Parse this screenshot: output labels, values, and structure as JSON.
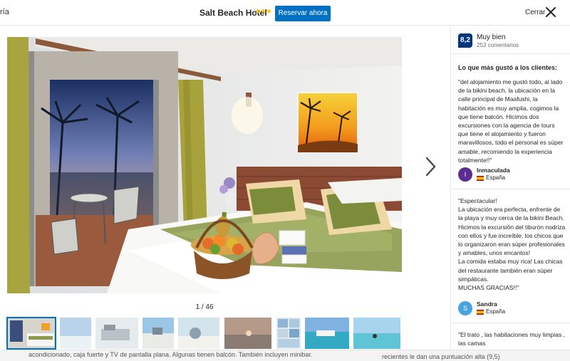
{
  "header": {
    "breadcrumb_fragment": "ría",
    "hotel_name": "Salt Beach Hotel",
    "stars": "★★★",
    "reserve_label": "Reservar ahora",
    "close_label": "Cerrar"
  },
  "gallery": {
    "counter": "1 / 46",
    "thumbnail_count": 10,
    "active_thumbnail": 1
  },
  "background_page": {
    "left_text": "acondicionado, caja fuerte y TV de pantalla plana. Algunas tienen balcón. También incluyen minibar.",
    "right_text": "recientes le dan una puntuación alta (9,5)"
  },
  "sidebar": {
    "score": "8,2",
    "score_word": "Muy bien",
    "review_count": "253 comentarios",
    "liked_heading": "Lo que más gustó a los clientes:",
    "reviews": [
      {
        "text": "\"del alojamiento me gustó todo, al lado de la bikini beach, la ubicación en la calle principal de Maafushi, la habitación es muy amplia, cogimos la que tiene balcón. Hicimos dos excursiones con la agencia de tours que tiene el alojamiento y fueron maravillosos, todo el personal es súper amable, recomiendo la experiencia totalmente!!\"",
        "initial": "I",
        "name": "Inmaculada",
        "country": "España",
        "avatar_color": "#5c2d91"
      },
      {
        "text": "\"Espectacular!\nLa ubicación era perfecta, enfrente de la playa y muy cerca de la bikini Beach. Hicimos la excursión del tiburón nodriza con ellos y fue increíble, los chicos que lo organizaron eran súper profesionales y amables, unos encantos!\nLa comida estaba muy rica! Las chicas del restaurante también eran súper simpáticas.\nMUCHAS GRACIAS!!\"",
        "initial": "S",
        "name": "Sandra",
        "country": "España",
        "avatar_color": "#4aa3df"
      },
      {
        "text": "\"El trato , las habitaciones muy limpias , las camas\nmuy buenas, hemos estado muy bien",
        "initial": "",
        "name": "",
        "country": "",
        "avatar_color": ""
      }
    ]
  }
}
